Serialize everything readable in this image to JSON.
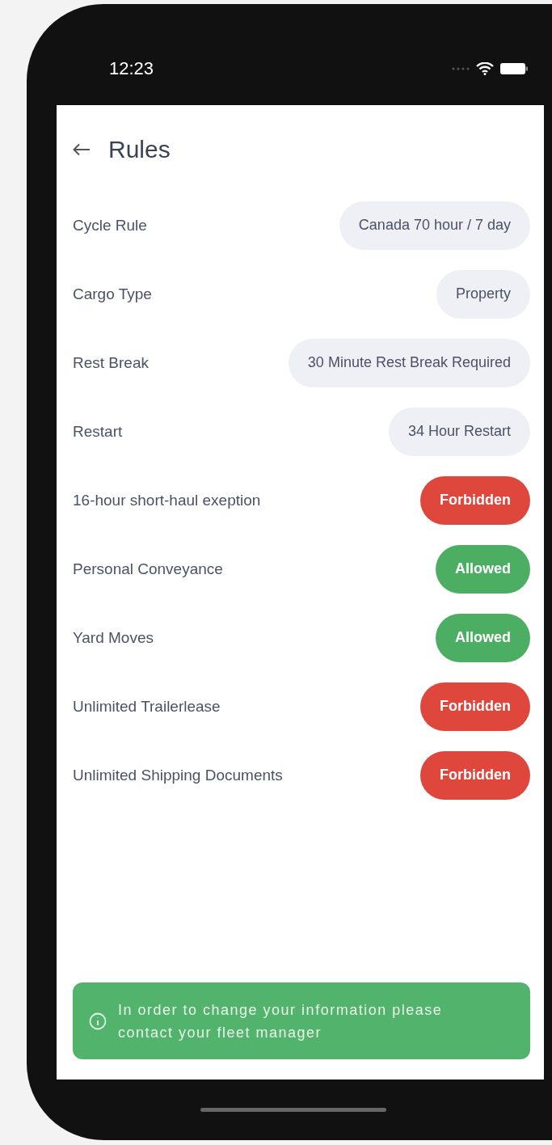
{
  "status_bar": {
    "time": "12:23"
  },
  "header": {
    "title": "Rules"
  },
  "rules": [
    {
      "label": "Cycle Rule",
      "value": "Canada 70 hour / 7 day",
      "kind": "neutral"
    },
    {
      "label": "Cargo Type",
      "value": "Property",
      "kind": "neutral"
    },
    {
      "label": "Rest Break",
      "value": "30 Minute Rest Break Required",
      "kind": "neutral"
    },
    {
      "label": "Restart",
      "value": "34 Hour Restart",
      "kind": "neutral"
    },
    {
      "label": "16-hour short-haul exeption",
      "value": "Forbidden",
      "kind": "forbidden"
    },
    {
      "label": "Personal Conveyance",
      "value": "Allowed",
      "kind": "allowed"
    },
    {
      "label": "Yard Moves",
      "value": "Allowed",
      "kind": "allowed"
    },
    {
      "label": "Unlimited Trailerlease",
      "value": "Forbidden",
      "kind": "forbidden"
    },
    {
      "label": "Unlimited Shipping Documents",
      "value": "Forbidden",
      "kind": "forbidden"
    }
  ],
  "notice": {
    "text": "In order to change your information please contact your fleet manager"
  }
}
